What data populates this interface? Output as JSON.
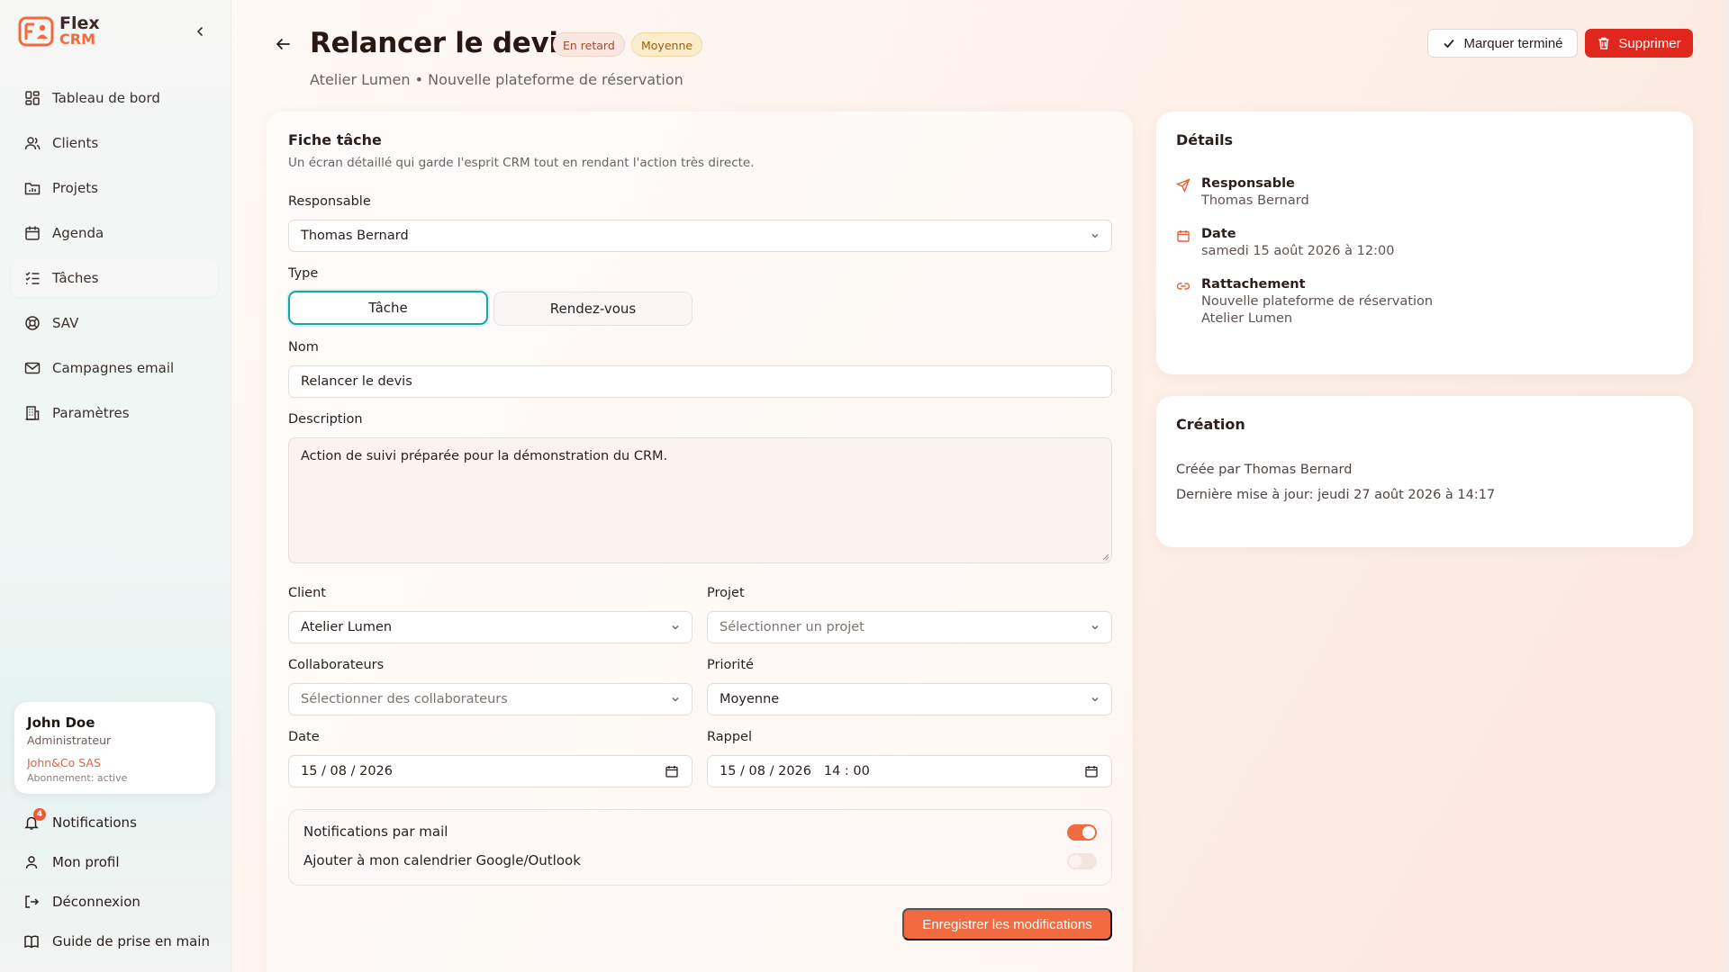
{
  "brand": {
    "name": "Flex",
    "sub": "CRM"
  },
  "sidebar": {
    "items": [
      {
        "label": "Tableau de bord",
        "icon": "dashboard-icon"
      },
      {
        "label": "Clients",
        "icon": "users-icon"
      },
      {
        "label": "Projets",
        "icon": "folder-chart-icon"
      },
      {
        "label": "Agenda",
        "icon": "calendar-icon"
      },
      {
        "label": "Tâches",
        "icon": "task-list-icon",
        "active": true
      },
      {
        "label": "SAV",
        "icon": "lifebuoy-icon"
      },
      {
        "label": "Campagnes email",
        "icon": "mail-icon"
      },
      {
        "label": "Paramètres",
        "icon": "building-icon"
      }
    ],
    "user": {
      "name": "John Doe",
      "role": "Administrateur",
      "company": "John&Co SAS",
      "subscription": "Abonnement: active"
    },
    "bottom": {
      "notifications": "Notifications",
      "notifications_count": "4",
      "profile": "Mon profil",
      "logout": "Déconnexion",
      "guide": "Guide de prise en main"
    }
  },
  "header": {
    "title": "Relancer le devis",
    "tag_status": "En retard",
    "tag_priority": "Moyenne",
    "subtitle": "Atelier Lumen • Nouvelle plateforme de réservation",
    "done_label": "Marquer terminé",
    "delete_label": "Supprimer"
  },
  "form": {
    "title": "Fiche tâche",
    "description_text": "Un écran détaillé qui garde l'esprit CRM tout en rendant l'action très directe.",
    "responsable_label": "Responsable",
    "responsable_value": "Thomas Bernard",
    "type_label": "Type",
    "type_options": [
      "Tâche",
      "Rendez-vous"
    ],
    "type_selected": "Tâche",
    "name_label": "Nom",
    "name_value": "Relancer le devis",
    "description_label": "Description",
    "description_value": "Action de suivi préparée pour la démonstration du CRM.",
    "client_label": "Client",
    "client_value": "Atelier Lumen",
    "project_label": "Projet",
    "project_placeholder": "Sélectionner un projet",
    "collab_label": "Collaborateurs",
    "collab_placeholder": "Sélectionner des collaborateurs",
    "priority_label": "Priorité",
    "priority_value": "Moyenne",
    "date_label": "Date",
    "date_value": "15 / 08 / 2026",
    "reminder_label": "Rappel",
    "reminder_value": "15 / 08 / 2026   14 : 00",
    "toggle_mail_label": "Notifications par mail",
    "toggle_mail_on": true,
    "toggle_calendar_label": "Ajouter à mon calendrier Google/Outlook",
    "toggle_calendar_on": false,
    "save_label": "Enregistrer les modifications"
  },
  "details": {
    "title": "Détails",
    "responsable_label": "Responsable",
    "responsable_value": "Thomas Bernard",
    "date_label": "Date",
    "date_value": "samedi 15 août 2026 à 12:00",
    "attach_label": "Rattachement",
    "attach_project": "Nouvelle plateforme de réservation",
    "attach_client": "Atelier Lumen"
  },
  "creation": {
    "title": "Création",
    "created_by": "Créée par Thomas Bernard",
    "updated": "Dernière mise à jour: jeudi 27 août 2026 à 14:17"
  },
  "colors": {
    "accent": "#f26a3f",
    "danger": "#e1261d",
    "teal": "#1aa3a8"
  }
}
